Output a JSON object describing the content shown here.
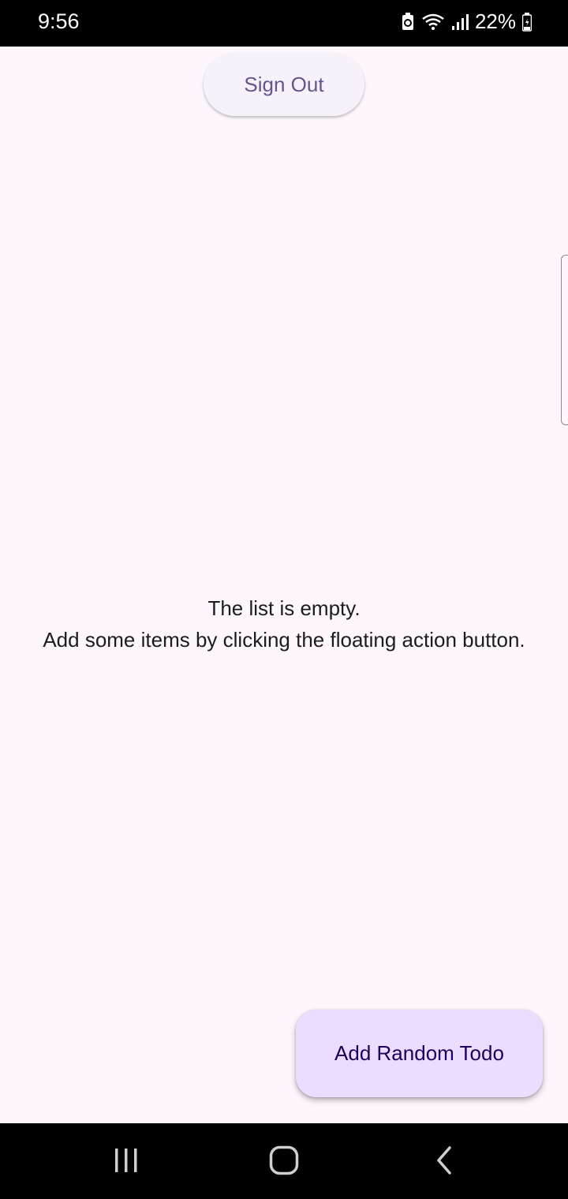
{
  "status_bar": {
    "time": "9:56",
    "battery_percent": "22%",
    "icons": [
      "battery-saver-icon",
      "wifi-icon",
      "signal-icon",
      "battery-icon"
    ]
  },
  "header": {
    "sign_out_label": "Sign Out"
  },
  "main": {
    "empty_line_1": "The list is empty.",
    "empty_line_2": "Add some items by clicking the floating action button."
  },
  "fab": {
    "label": "Add Random Todo"
  },
  "nav_bar": {
    "icons": [
      "recents-icon",
      "home-icon",
      "back-icon"
    ]
  },
  "colors": {
    "background": "#fdf7fd",
    "primary": "#65558f",
    "fab_container": "#eaddff",
    "fab_text": "#21005d",
    "text": "#1d1b20"
  }
}
